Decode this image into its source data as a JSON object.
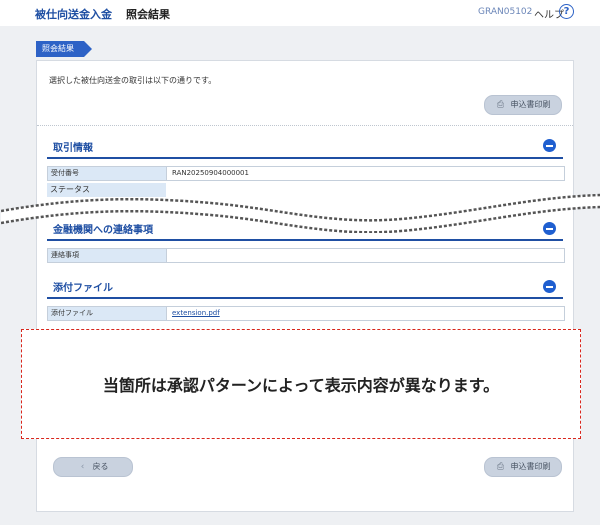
{
  "header": {
    "app_title": "被仕向送金入金",
    "page_title": "照会結果",
    "screen_id": "GRAN05102",
    "help_label": "ヘルプ",
    "help_icon": "question-circle-icon"
  },
  "breadcrumb": {
    "current": "照会結果"
  },
  "panel": {
    "description": "選択した被仕向送金の取引は以下の通りです。",
    "print_button": "申込書印刷",
    "back_button": "戻る"
  },
  "sections": {
    "transaction": {
      "title": "取引情報",
      "rows": [
        {
          "label": "受付番号",
          "value": "RAN20250904000001"
        },
        {
          "label": "ステータス",
          "value": ""
        }
      ]
    },
    "contact": {
      "title": "金融機関への連絡事項",
      "rows": [
        {
          "label": "連絡事項",
          "value": ""
        }
      ]
    },
    "attachment": {
      "title": "添付ファイル",
      "rows": [
        {
          "label": "添付ファイル",
          "value": "extension.pdf"
        }
      ]
    }
  },
  "note": "当箇所は承認パターンによって表示内容が異なります。"
}
